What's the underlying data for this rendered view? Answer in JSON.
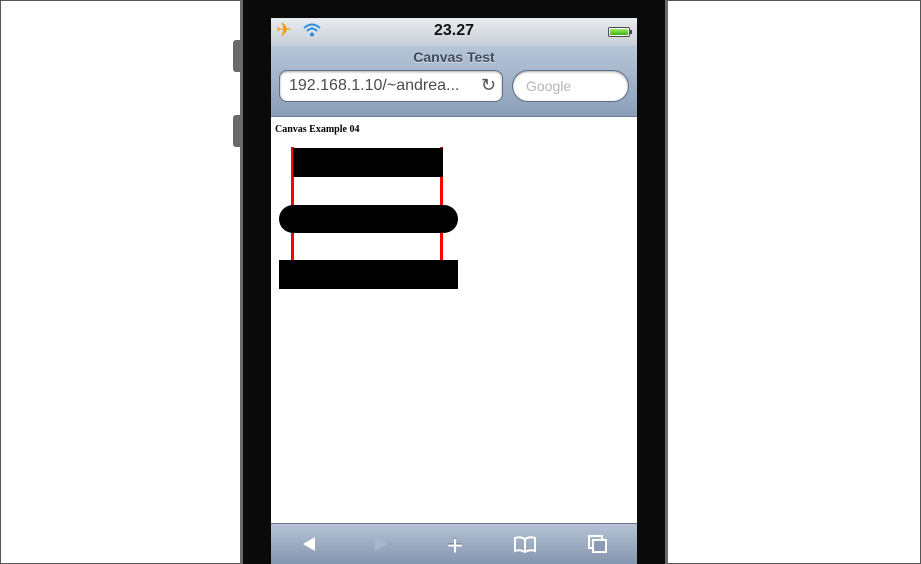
{
  "status_bar": {
    "airplane_icon": "airplane-icon",
    "wifi_icon": "wifi-icon",
    "time": "23.27",
    "battery_icon": "battery-icon",
    "airplane_color": "#f29b12"
  },
  "browser": {
    "page_title": "Canvas Test",
    "url": "192.168.1.10/~andrea...",
    "reload_icon": "reload-icon",
    "search_placeholder": "Google"
  },
  "page": {
    "heading": "Canvas Example 04",
    "canvas_colors": {
      "bars": "#000000",
      "lines": "#ff0000"
    }
  },
  "toolbar": {
    "back_icon": "back-arrow-icon",
    "forward_icon": "forward-arrow-icon",
    "add_icon": "plus-icon",
    "bookmarks_icon": "bookmarks-book-icon",
    "pages_icon": "pages-icon",
    "forward_enabled": false
  }
}
